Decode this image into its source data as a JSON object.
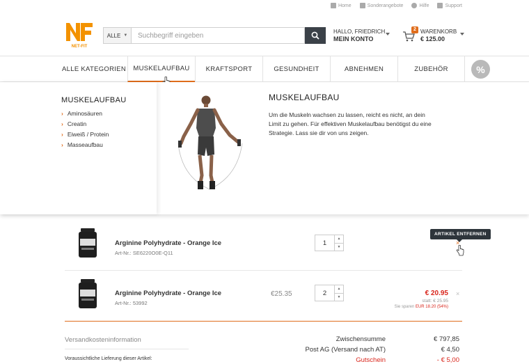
{
  "topbar": {
    "links": [
      "Home",
      "Sonderangebote",
      "Hilfe",
      "Support"
    ]
  },
  "header": {
    "logo_text": "NF",
    "logo_sub": "NET-FIT",
    "search_category": "ALLE",
    "search_placeholder": "Suchbegriff eingeben",
    "greeting": "HALLO, FRIEDRICH",
    "account_label": "MEIN KONTO",
    "cart_count": "2",
    "cart_label": "WARENKORB",
    "cart_total": "€ 125.00"
  },
  "nav": {
    "items": [
      "ALLE KATEGORIEN",
      "MUSKELAUFBAU",
      "KRAFTSPORT",
      "GESUNDHEIT",
      "ABNEHMEN",
      "ZUBEHÖR"
    ],
    "active": "MUSKELAUFBAU",
    "sale_icon": "%"
  },
  "mega": {
    "category_title": "MUSKELAUFBAU",
    "subcategories": [
      "Aminosäuren",
      "Creatin",
      "Eiweiß / Protein",
      "Masseaufbau"
    ],
    "heading": "MUSKELAUFBAU",
    "description": "Um die Muskeln wachsen zu lassen, reicht es nicht, an dein Limit zu gehen. Für effektiven Muskelaufbau benötigst du eine Strategie. Lass sie dir von uns zeigen."
  },
  "cart": {
    "items": [
      {
        "name": "Arginine Polyhydrate - Orange Ice",
        "art_nr": "Art-Nr.: SE6220O0E-Q11",
        "qty": "1",
        "tooltip": "ARTIKEL ENTFERNEN",
        "remove": "×"
      },
      {
        "name": "Arginine Polyhydrate - Orange Ice",
        "art_nr": "Art-Nr.: 53992",
        "unit_price": "€25.35",
        "qty": "2",
        "price": "€ 20.95",
        "old_price": "statt: € 25.95",
        "savings_label": "Sie sparen",
        "savings_value": "EUR 18.20 (54%)",
        "remove": "×"
      }
    ]
  },
  "shipping": {
    "title": "Versandkosteninformation",
    "note": "Voraussichtliche Lieferung dieser Artikel:"
  },
  "summary": {
    "subtotal_label": "Zwischensumme",
    "subtotal_value": "€ 797,85",
    "shipping_label": "Post AG (Versand nach AT)",
    "shipping_value": "€ 4,50",
    "voucher_label": "Gutschein",
    "voucher_value": "- € 5,00"
  },
  "colors": {
    "accent": "#e06d1c",
    "dark": "#3b4148",
    "red": "#d9261c"
  }
}
